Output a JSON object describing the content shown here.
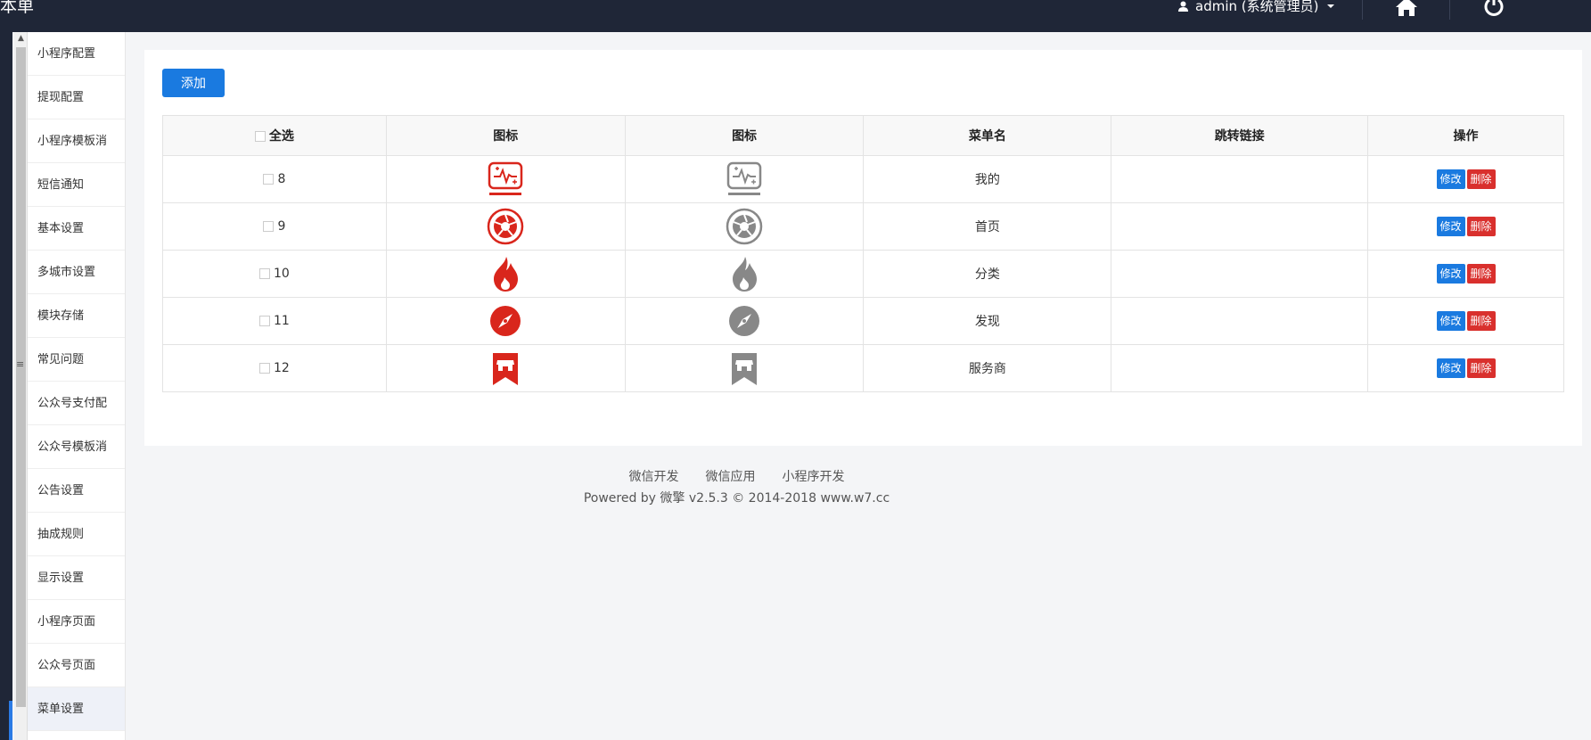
{
  "topbar": {
    "brand": "本单",
    "user_label": "admin (系统管理员)",
    "icons": [
      "user-icon",
      "home-icon",
      "power-icon"
    ]
  },
  "sidebar": {
    "items": [
      {
        "label": "小程序配置"
      },
      {
        "label": "提现配置"
      },
      {
        "label": "小程序模板消"
      },
      {
        "label": "短信通知"
      },
      {
        "label": "基本设置"
      },
      {
        "label": "多城市设置"
      },
      {
        "label": "模块存储"
      },
      {
        "label": "常见问题"
      },
      {
        "label": "公众号支付配"
      },
      {
        "label": "公众号模板消"
      },
      {
        "label": "公告设置"
      },
      {
        "label": "抽成规则"
      },
      {
        "label": "显示设置"
      },
      {
        "label": "小程序页面"
      },
      {
        "label": "公众号页面"
      },
      {
        "label": "菜单设置"
      }
    ],
    "active_index": 15
  },
  "main": {
    "add_label": "添加",
    "table": {
      "headers": [
        "全选",
        "图标",
        "图标",
        "菜单名",
        "跳转链接",
        "操作"
      ],
      "rows": [
        {
          "id": "8",
          "icon_active": "monitor-pulse-icon",
          "icon_inactive": "monitor-pulse-icon",
          "name": "我的",
          "link": ""
        },
        {
          "id": "9",
          "icon_active": "aperture-icon",
          "icon_inactive": "aperture-icon",
          "name": "首页",
          "link": ""
        },
        {
          "id": "10",
          "icon_active": "flame-icon",
          "icon_inactive": "flame-icon",
          "name": "分类",
          "link": ""
        },
        {
          "id": "11",
          "icon_active": "compass-icon",
          "icon_inactive": "compass-icon",
          "name": "发现",
          "link": ""
        },
        {
          "id": "12",
          "icon_active": "store-bookmark-icon",
          "icon_inactive": "store-bookmark-icon",
          "name": "服务商",
          "link": ""
        }
      ],
      "edit_label": "修改",
      "delete_label": "删除"
    }
  },
  "footer": {
    "links": [
      "微信开发",
      "微信应用",
      "小程序开发"
    ],
    "powered": "Powered by 微擎 v2.5.3 © 2014-2018 www.w7.cc"
  },
  "colors": {
    "topbar": "#1f2637",
    "primary": "#1a7ae0",
    "danger": "#d9302d",
    "icon_active": "#d9261c",
    "icon_inactive": "#888888"
  }
}
